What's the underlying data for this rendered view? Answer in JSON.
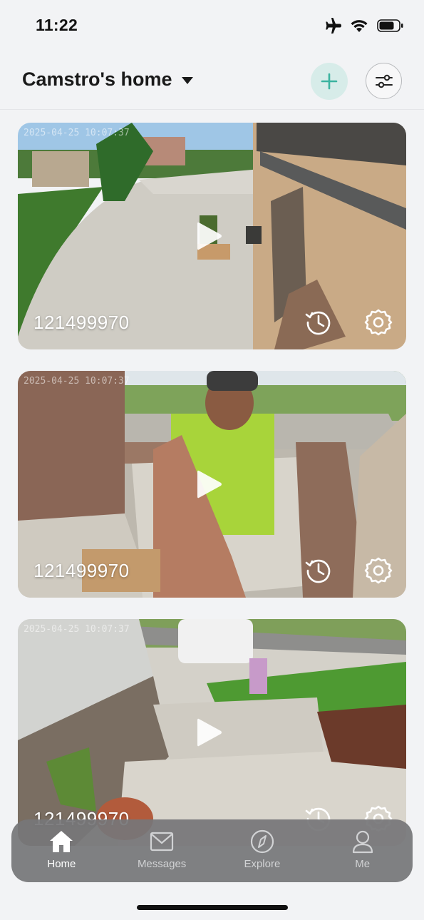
{
  "status_bar": {
    "time": "11:22",
    "icons": [
      "airplane-icon",
      "wifi-icon",
      "battery-icon"
    ]
  },
  "header": {
    "home_name": "Camstro's home",
    "dropdown_icon": "caret-down-icon",
    "add_icon": "plus-icon",
    "settings_icon": "sliders-icon"
  },
  "cameras": [
    {
      "name": "121499970",
      "timestamp": "2025-04-25 10:07:37"
    },
    {
      "name": "121499970",
      "timestamp": "2025-04-25 10:07:37"
    },
    {
      "name": "121499970",
      "timestamp": "2025-04-25 10:07:37"
    }
  ],
  "tabs": [
    {
      "label": "Home",
      "icon": "home-icon",
      "active": true
    },
    {
      "label": "Messages",
      "icon": "mail-icon",
      "active": false
    },
    {
      "label": "Explore",
      "icon": "compass-icon",
      "active": false
    },
    {
      "label": "Me",
      "icon": "person-icon",
      "active": false
    }
  ],
  "colors": {
    "accent": "#3bb3a0",
    "add_button_bg": "#d7ece9",
    "tab_bar_bg": "#767678",
    "page_bg": "#f2f3f5"
  }
}
